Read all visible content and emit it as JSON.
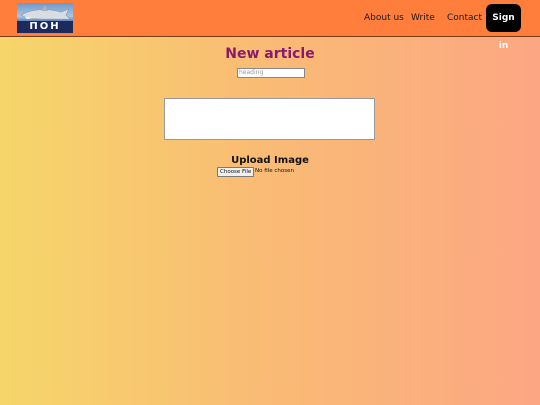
{
  "nav": {
    "logo_text": "ПОН",
    "links": [
      "About us",
      "Write",
      "Contact"
    ],
    "signin_label": "Sign in"
  },
  "editor": {
    "title": "New article",
    "heading_placeholder": "heading",
    "body_value": "",
    "upload_label": "Upload Image",
    "choose_file_label": "Choose File",
    "file_status": "No file chosen"
  },
  "colors": {
    "navbar": "#ff7e3c",
    "title": "#8b1a6d",
    "signin_bg": "#000000"
  }
}
